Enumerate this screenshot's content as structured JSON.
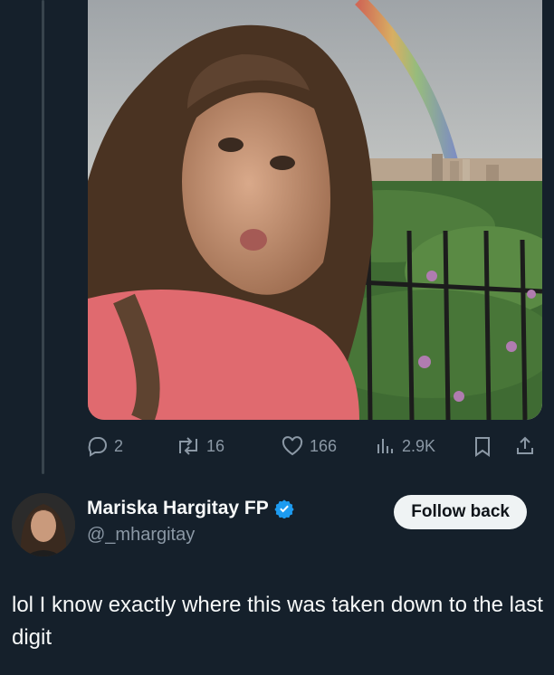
{
  "reply_context": {
    "media": {
      "description_icon": "photo"
    },
    "actions": {
      "replies": "2",
      "reposts": "16",
      "likes": "166",
      "views": "2.9K"
    }
  },
  "reply": {
    "author_name": "Mariska Hargitay FP",
    "handle": "@_mhargitay",
    "verified": true,
    "follow_label": "Follow back",
    "text": "lol I know exactly where this was taken down to the last digit"
  },
  "colors": {
    "background": "#15202b",
    "muted": "#8b98a5",
    "verified": "#1d9bf0",
    "button_bg": "#eff3f4"
  }
}
